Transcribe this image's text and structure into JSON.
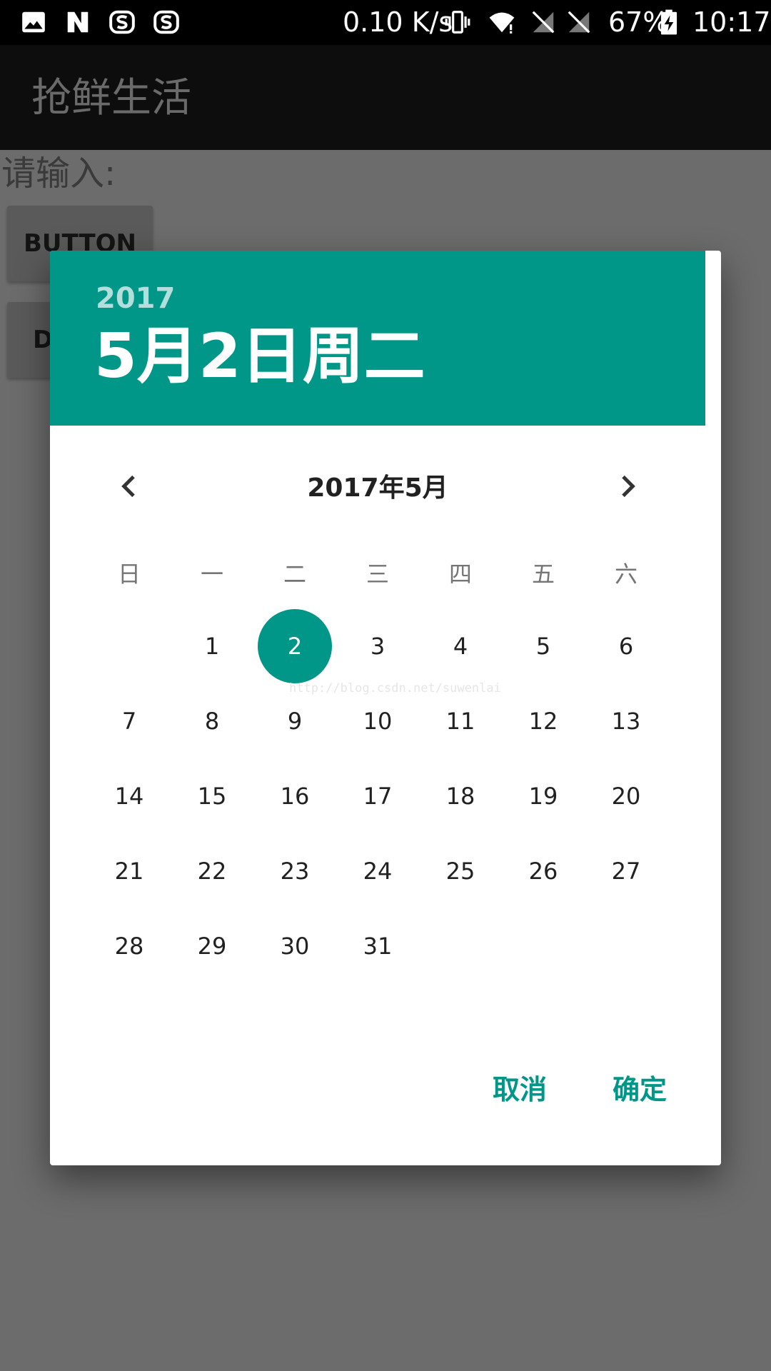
{
  "status_bar": {
    "net_speed": "0.10 K/s",
    "battery": "67%",
    "time": "10:17"
  },
  "app_bar": {
    "title": "抢鲜生活"
  },
  "content": {
    "prompt_label": "请输入:",
    "button1_label": "BUTTON",
    "button2_label": "D"
  },
  "dialog": {
    "header": {
      "year": "2017",
      "date": "5月2日周二"
    },
    "month_title": "2017年5月",
    "weekdays": [
      "日",
      "一",
      "二",
      "三",
      "四",
      "五",
      "六"
    ],
    "days": [
      [
        "",
        "1",
        "2",
        "3",
        "4",
        "5",
        "6"
      ],
      [
        "7",
        "8",
        "9",
        "10",
        "11",
        "12",
        "13"
      ],
      [
        "14",
        "15",
        "16",
        "17",
        "18",
        "19",
        "20"
      ],
      [
        "21",
        "22",
        "23",
        "24",
        "25",
        "26",
        "27"
      ],
      [
        "28",
        "29",
        "30",
        "31",
        "",
        "",
        ""
      ]
    ],
    "selected_day": "2",
    "watermark": "http://blog.csdn.net/suwenlai",
    "cancel_label": "取消",
    "ok_label": "确定"
  },
  "colors": {
    "accent": "#009688",
    "accent_light": "#b2dfdb",
    "scrim": "#6c6c6c"
  }
}
